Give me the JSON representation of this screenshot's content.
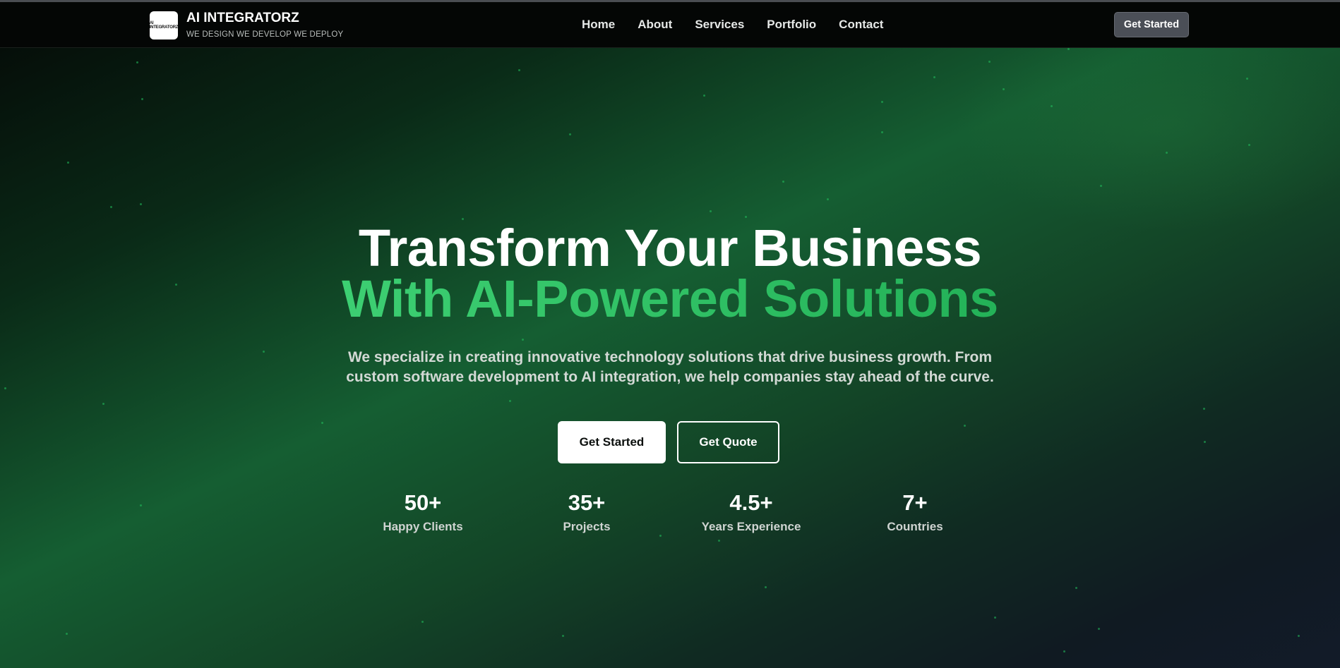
{
  "brand": {
    "logo_text": "AI INTEGRATORZ",
    "name": "AI INTEGRATORZ",
    "tagline": "WE DESIGN WE DEVELOP WE DEPLOY"
  },
  "nav": {
    "items": [
      "Home",
      "About",
      "Services",
      "Portfolio",
      "Contact"
    ],
    "cta_label": "Get Started"
  },
  "hero": {
    "title_line1": "Transform Your Business",
    "title_line2": "With AI-Powered Solutions",
    "subtitle_line1": "We specialize in creating innovative technology solutions that drive business growth. From",
    "subtitle_line2": "custom software development to AI integration, we help companies stay ahead of the curve.",
    "primary_button": "Get Started",
    "secondary_button": "Get Quote"
  },
  "stats": [
    {
      "value": "50+",
      "label": "Happy Clients"
    },
    {
      "value": "35+",
      "label": "Projects"
    },
    {
      "value": "4.5+",
      "label": "Years Experience"
    },
    {
      "value": "7+",
      "label": "Countries"
    }
  ],
  "colors": {
    "accent_green": "#22c55e",
    "header_bg": "#040605",
    "nav_button_bg": "#4b4f57"
  }
}
